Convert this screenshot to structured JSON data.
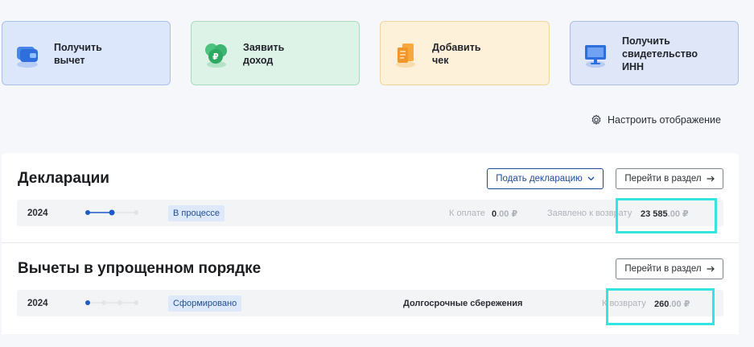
{
  "actions": [
    {
      "label": "Получить\nвычет",
      "icon": "wallet-icon"
    },
    {
      "label": "Заявить\nдоход",
      "icon": "ruble-coin-icon"
    },
    {
      "label": "Добавить\nчек",
      "icon": "receipt-icon"
    },
    {
      "label": "Получить\nсвидетельство\nИНН",
      "icon": "monitor-icon"
    }
  ],
  "settings_label": "Настроить отображение",
  "declarations": {
    "title": "Декларации",
    "submit_button": "Подать декларацию",
    "goto_button": "Перейти в раздел",
    "row": {
      "year": "2024",
      "progress_done": 2,
      "progress_total": 3,
      "status": "В процессе",
      "to_pay_label": "К оплате",
      "to_pay_int": "0",
      "to_pay_dec": ".00 ₽",
      "refund_label": "Заявлено к возврату",
      "refund_int": "23 585",
      "refund_dec": ".00 ₽"
    }
  },
  "simplified": {
    "title": "Вычеты в упрощенном порядке",
    "goto_button": "Перейти в раздел",
    "row": {
      "year": "2024",
      "progress_done": 1,
      "progress_total": 4,
      "status": "Сформировано",
      "category": "Долгосрочные сбережения",
      "refund_label": "К возврату",
      "refund_int": "260",
      "refund_dec": ".00 ₽"
    }
  },
  "colors": {
    "highlight": "#33e4e0",
    "primary": "#1f4a9a",
    "badge_bg": "#dde8fb"
  }
}
